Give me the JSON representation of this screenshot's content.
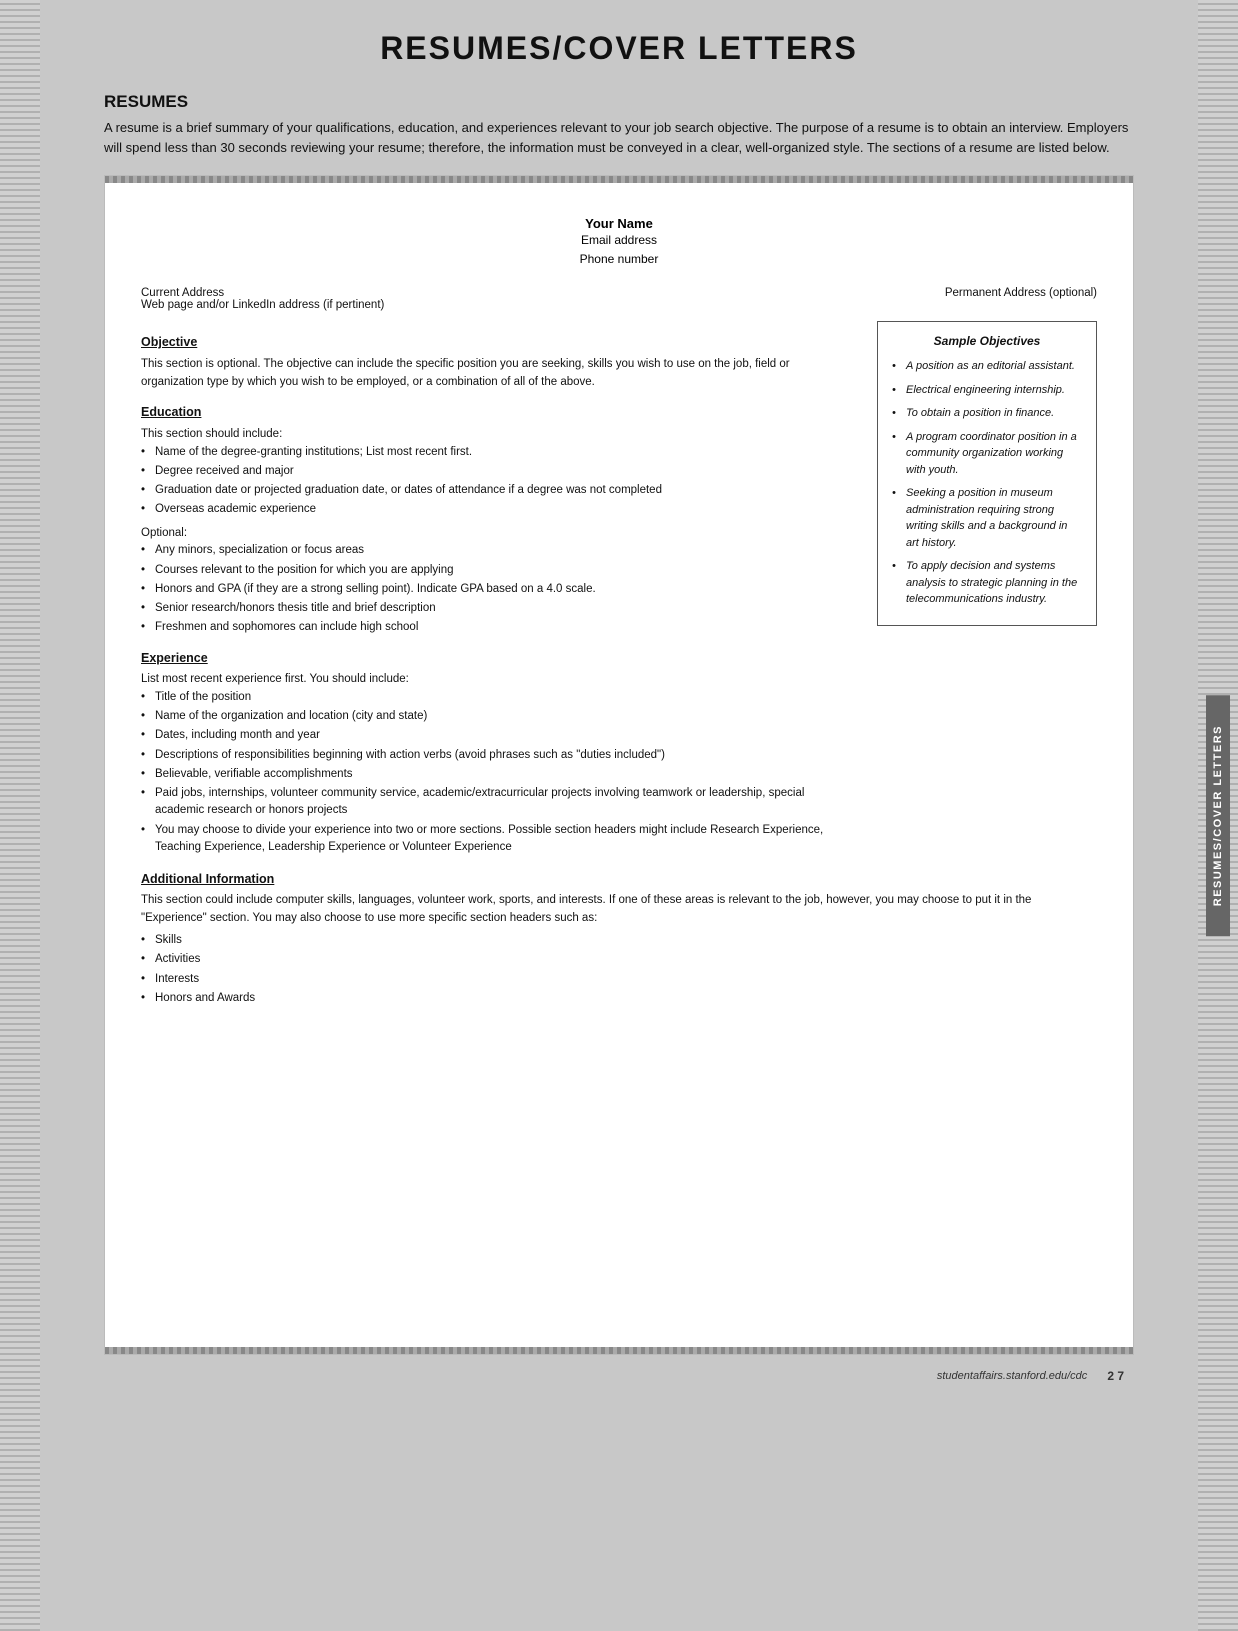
{
  "page": {
    "title": "RESUMES/COVER LETTERS",
    "footer_url": "studentaffairs.stanford.edu/cdc",
    "footer_page": "2 7"
  },
  "resumes_section": {
    "heading": "RESUMES",
    "intro": "A resume is a brief summary of your qualifications, education, and experiences relevant to your job search objective. The purpose of a resume is to obtain an interview. Employers will spend less than 30 seconds reviewing your resume; therefore, the information must be conveyed in a clear, well-organized style. The sections of a resume are listed below."
  },
  "resume_template": {
    "name": "Your Name",
    "email": "Email address",
    "phone": "Phone number",
    "current_address": "Current Address",
    "web": "Web page and/or LinkedIn address (if pertinent)",
    "permanent_address": "Permanent Address (optional)"
  },
  "objective_section": {
    "title": "Objective",
    "body": "This section is optional. The objective can include the specific position you are seeking, skills you wish to use on the job, field or organization type by which you wish to be employed, or a combination of all of the above."
  },
  "education_section": {
    "title": "Education",
    "intro": "This section should include:",
    "required_items": [
      "Name of the degree-granting institutions; List most recent first.",
      "Degree received and major",
      "Graduation date or projected graduation date, or dates of attendance if a degree was not completed",
      "Overseas academic experience"
    ],
    "optional_label": "Optional:",
    "optional_items": [
      "Any minors, specialization or focus areas",
      "Courses relevant to the position for which you are applying",
      "Honors and GPA (if they are a strong selling point). Indicate GPA based on a 4.0 scale.",
      "Senior research/honors thesis title and brief description",
      "Freshmen and sophomores can include high school"
    ]
  },
  "experience_section": {
    "title": "Experience",
    "intro": "List most recent experience first. You should include:",
    "items": [
      "Title of the position",
      "Name of the organization and location (city and state)",
      "Dates, including month and year",
      "Descriptions of responsibilities beginning with action verbs (avoid phrases such as \"duties included\")",
      "Believable, verifiable accomplishments",
      "Paid jobs, internships, volunteer community service, academic/extracurricular projects involving teamwork or leadership, special academic research or honors projects",
      "You may choose to divide your experience into two or more sections. Possible section headers might include Research Experience, Teaching Experience, Leadership Experience or Volunteer Experience"
    ]
  },
  "additional_info_section": {
    "title": "Additional Information",
    "body": "This section could include computer skills, languages, volunteer work, sports, and interests. If one of these areas is relevant to the job, however, you may choose to put it in the \"Experience\" section. You may also choose to use more specific section headers such as:",
    "items": [
      "Skills",
      "Activities",
      "Interests",
      "Honors and Awards"
    ]
  },
  "sample_objectives": {
    "title": "Sample Objectives",
    "items": [
      "A position as an editorial assistant.",
      "Electrical engineering internship.",
      "To obtain a position in finance.",
      "A program coordinator position in a community organization working with youth.",
      "Seeking a position in museum administration requiring strong writing skills and a background in art history.",
      "To apply decision and systems analysis to strategic planning in the telecommunications industry."
    ]
  },
  "side_tab": {
    "label": "RESUMES/COVER LETTERS"
  }
}
